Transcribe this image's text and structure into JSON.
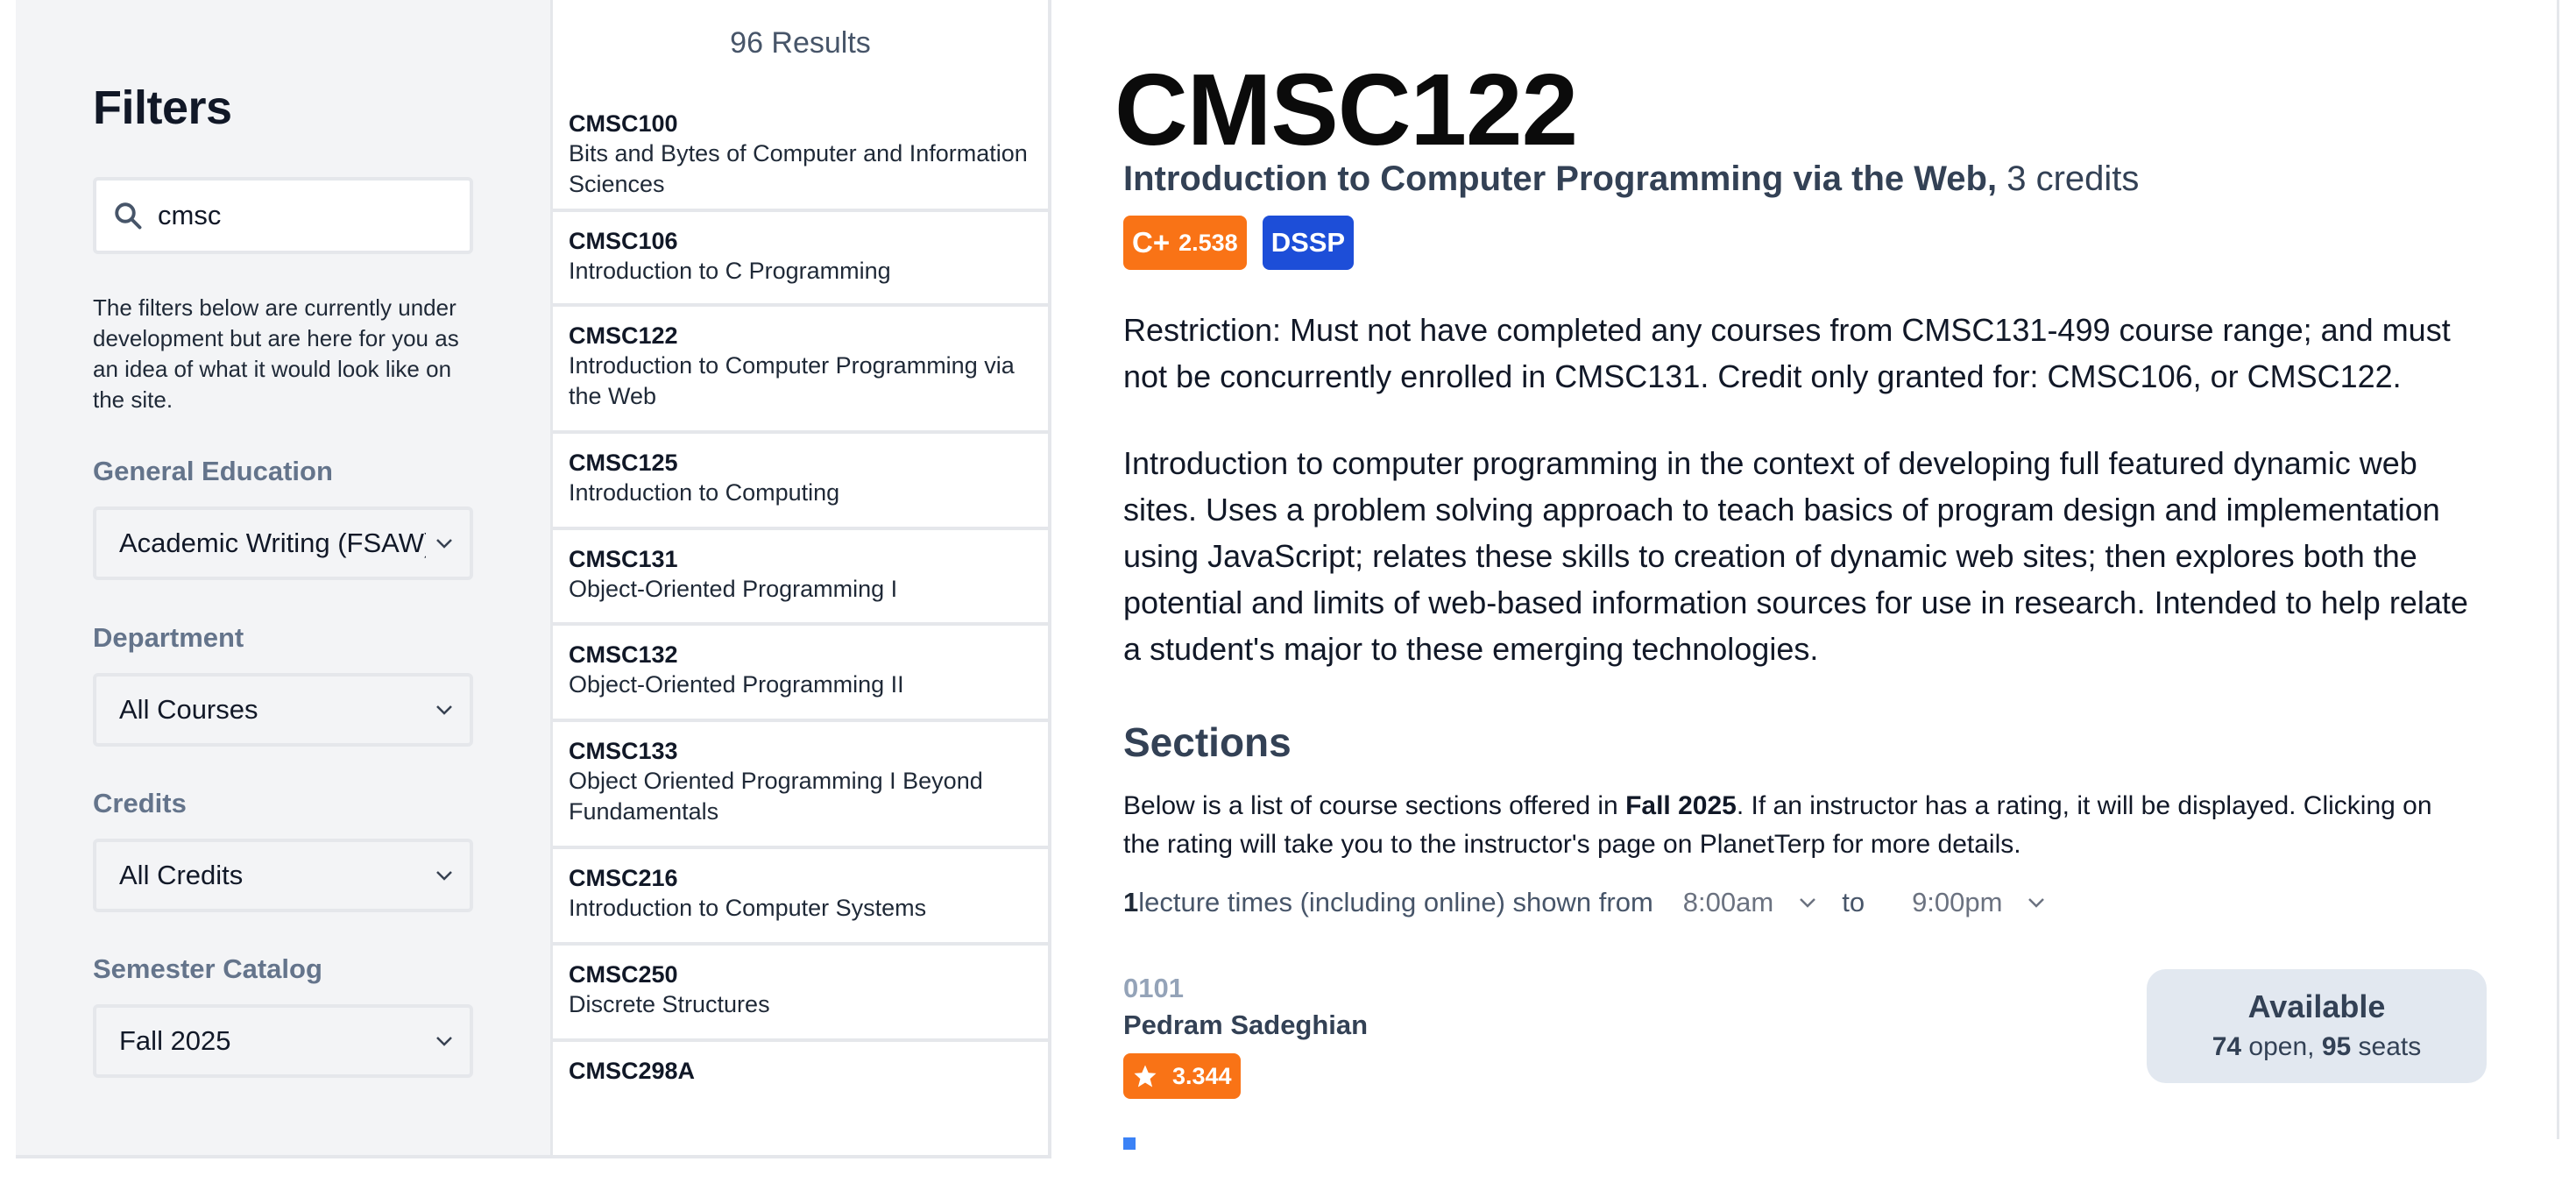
{
  "filters": {
    "heading": "Filters",
    "search_value": "cmsc",
    "note": "The filters below are currently under development but are here for you as an idea of what it would look like on the site.",
    "general_education": {
      "label": "General Education",
      "selected": "Academic Writing (FSAW)"
    },
    "department": {
      "label": "Department",
      "selected": "All Courses"
    },
    "credits": {
      "label": "Credits",
      "selected": "All Credits"
    },
    "semester_catalog": {
      "label": "Semester Catalog",
      "selected": "Fall 2025"
    }
  },
  "results": {
    "count_label": "96 Results",
    "items": [
      {
        "code": "CMSC100",
        "title": "Bits and Bytes of Computer and Information Sciences"
      },
      {
        "code": "CMSC106",
        "title": "Introduction to C Programming"
      },
      {
        "code": "CMSC122",
        "title": "Introduction to Computer Programming via the Web"
      },
      {
        "code": "CMSC125",
        "title": "Introduction to Computing"
      },
      {
        "code": "CMSC131",
        "title": "Object-Oriented Programming I"
      },
      {
        "code": "CMSC132",
        "title": "Object-Oriented Programming II"
      },
      {
        "code": "CMSC133",
        "title": "Object Oriented Programming I Beyond Fundamentals"
      },
      {
        "code": "CMSC216",
        "title": "Introduction to Computer Systems"
      },
      {
        "code": "CMSC250",
        "title": "Discrete Structures"
      },
      {
        "code": "CMSC298A",
        "title": ""
      }
    ]
  },
  "course": {
    "code": "CMSC122",
    "title": "Introduction to Computer Programming via the Web,",
    "credits": "3 credits",
    "grade_letter": "C+",
    "grade_avg": "2.538",
    "gened_tag": "DSSP",
    "restriction": "Restriction: Must not have completed any courses from CMSC131-499 course range; and must not be concurrently enrolled in CMSC131. Credit only granted for: CMSC106, or CMSC122.",
    "description": "Introduction to computer programming in the context of developing full featured dynamic web sites. Uses a problem solving approach to teach basics of program design and implementation using JavaScript; relates these skills to creation of dynamic web sites; then explores both the potential and limits of web-based information sources for use in research. Intended to help relate a student's major to these emerging technologies."
  },
  "sections": {
    "heading": "Sections",
    "desc_prefix": "Below is a list of course sections offered in ",
    "desc_semester": "Fall 2025",
    "desc_suffix": ". If an instructor has a rating, it will be displayed. Clicking on the rating will take you to the instructor's page on PlanetTerp for more details.",
    "lecture_count": "1",
    "lecture_text": " lecture times (including online) shown from",
    "time_from": "8:00am",
    "to_label": "to",
    "time_to": "9:00pm",
    "section": {
      "number": "0101",
      "instructor": "Pedram Sadeghian",
      "rating": "3.344",
      "availability_label": "Available",
      "open": "74",
      "open_label": " open, ",
      "seats": "95",
      "seats_label": " seats"
    }
  },
  "colors": {
    "grade_badge": "#f97316",
    "gened_badge": "#1d4ed8",
    "label_gray": "#64748b"
  },
  "icons": {
    "search": "search-icon",
    "chevron": "chevron-down-icon",
    "star": "star-icon"
  }
}
